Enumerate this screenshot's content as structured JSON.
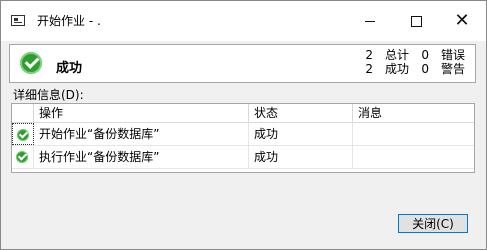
{
  "window": {
    "title": "开始作业 - ."
  },
  "summary": {
    "status": "成功",
    "stats": [
      {
        "n": "2",
        "label": "总计",
        "n2": "0",
        "label2": "错误"
      },
      {
        "n": "2",
        "label": "成功",
        "n2": "0",
        "label2": "警告"
      }
    ]
  },
  "details": {
    "label": "详细信息(D):",
    "columns": [
      "操作",
      "状态",
      "消息"
    ],
    "rows": [
      {
        "action": "开始作业“备份数据库”",
        "status": "成功",
        "message": ""
      },
      {
        "action": "执行作业“备份数据库”",
        "status": "成功",
        "message": ""
      }
    ]
  },
  "buttons": {
    "close": "关闭(C)"
  }
}
